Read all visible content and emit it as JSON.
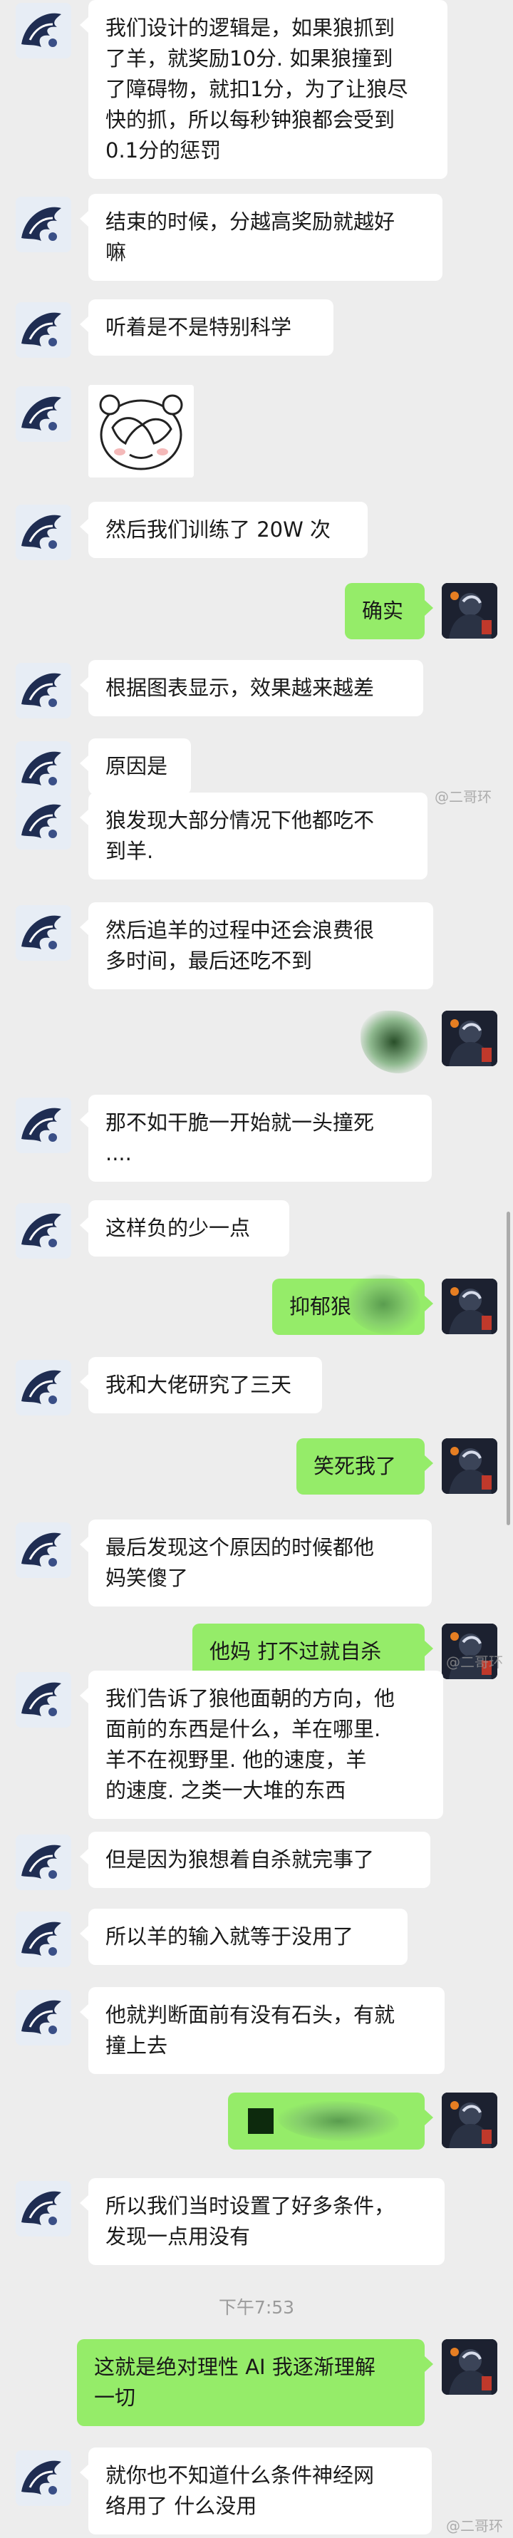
{
  "messages": [
    {
      "side": "left",
      "lines": [
        "我们设计的逻辑是，如果狼抓到",
        "了羊，就奖励10分. 如果狼撞到",
        "了障碍物，就扣1分，为了让狼尽",
        "快的抓，所以每秒钟狼都会受到",
        "0.1分的惩罚"
      ]
    },
    {
      "side": "left",
      "lines": [
        "结束的时候，分越高奖励就越好",
        "嘛"
      ]
    },
    {
      "side": "left",
      "lines": [
        "听着是不是特别科学"
      ]
    },
    {
      "side": "left",
      "lines": [
        "然后我们训练了 20W 次"
      ]
    },
    {
      "side": "right",
      "lines": [
        "确实"
      ]
    },
    {
      "side": "left",
      "lines": [
        "根据图表显示，效果越来越差"
      ]
    },
    {
      "side": "left",
      "lines": [
        "原因是"
      ]
    },
    {
      "side": "left",
      "lines": [
        "狼发现大部分情况下他都吃不",
        "到羊."
      ]
    },
    {
      "side": "left",
      "lines": [
        "然后追羊的过程中还会浪费很",
        "多时间，最后还吃不到"
      ]
    },
    {
      "side": "left",
      "lines": [
        "那不如干脆一开始就一头撞死",
        "...."
      ]
    },
    {
      "side": "left",
      "lines": [
        "这样负的少一点"
      ]
    },
    {
      "side": "right",
      "lines": [
        "抑郁狼"
      ]
    },
    {
      "side": "left",
      "lines": [
        "我和大佬研究了三天"
      ]
    },
    {
      "side": "right",
      "lines": [
        "笑死我了"
      ]
    },
    {
      "side": "left",
      "lines": [
        "最后发现这个原因的时候都他",
        "妈笑傻了"
      ]
    },
    {
      "side": "right",
      "lines": [
        "他妈 打不过就自杀"
      ]
    },
    {
      "side": "left",
      "lines": [
        "我们告诉了狼他面朝的方向，他",
        "面前的东西是什么，羊在哪里.",
        "羊不在视野里. 他的速度，羊",
        "的速度. 之类一大堆的东西"
      ]
    },
    {
      "side": "left",
      "lines": [
        "但是因为狼想着自杀就完事了"
      ]
    },
    {
      "side": "left",
      "lines": [
        "所以羊的输入就等于没用了"
      ]
    },
    {
      "side": "left",
      "lines": [
        "他就判断面前有没有石头，有就",
        "撞上去"
      ]
    },
    {
      "side": "left",
      "lines": [
        "所以我们当时设置了好多条件，",
        "发现一点用没有"
      ]
    },
    {
      "side": "right",
      "lines": [
        "这就是绝对理性 AI 我逐渐理解",
        "一切"
      ]
    },
    {
      "side": "left",
      "lines": [
        "就你也不知道什么条件神经网",
        "络用了 什么没用"
      ]
    }
  ],
  "timestamp": "下午7:53",
  "watermark": "@二哥环"
}
